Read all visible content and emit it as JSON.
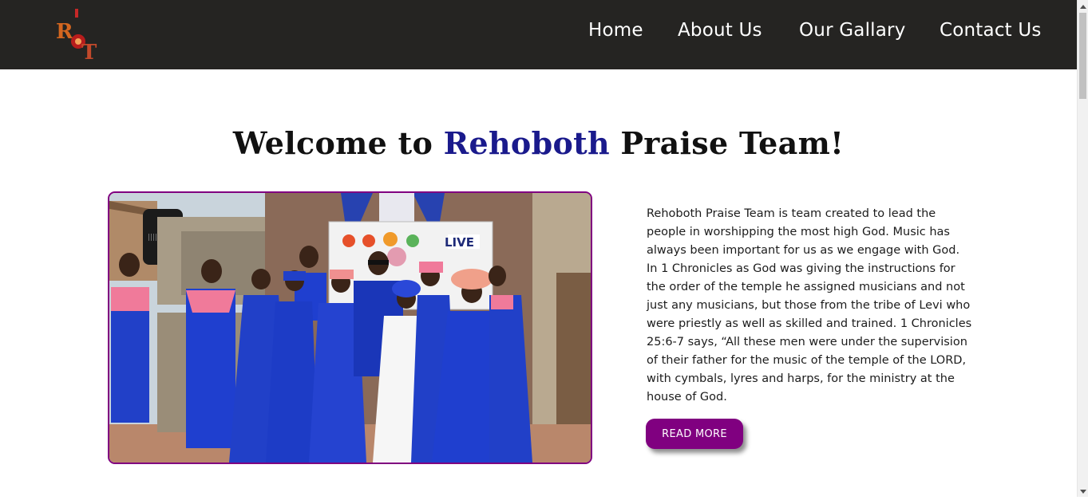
{
  "nav": {
    "logo_text": "RPT",
    "links": [
      {
        "label": "Home"
      },
      {
        "label": "About Us"
      },
      {
        "label": "Our Gallary"
      },
      {
        "label": "Contact Us"
      }
    ]
  },
  "hero": {
    "title_prefix": "Welcome to ",
    "title_brand": "Rehoboth",
    "title_suffix": " Praise Team!",
    "photo_banner_text": "LIVE"
  },
  "about": {
    "paragraph": "Rehoboth Praise Team is team created to lead the people in worshipping the most high God. Music has always been important for us as we engage with God. In 1 Chronicles as God was giving the instructions for the order of the temple he assigned musicians and not just any musicians, but those from the tribe of Levi who were priestly as well as skilled and trained. 1 Chronicles 25:6-7 says, “All these men were under the supervision of their father for the music of the temple of the LORD, with cymbals, lyres and harps, for the ministry at the house of God.",
    "button_label": "READ MORE"
  },
  "colors": {
    "navbar_bg": "#252422",
    "brand_accent": "#800080",
    "brand_title": "#1a1a8c",
    "uniform_blue": "#1f3fcf",
    "uniform_pink": "#f07a9a"
  }
}
